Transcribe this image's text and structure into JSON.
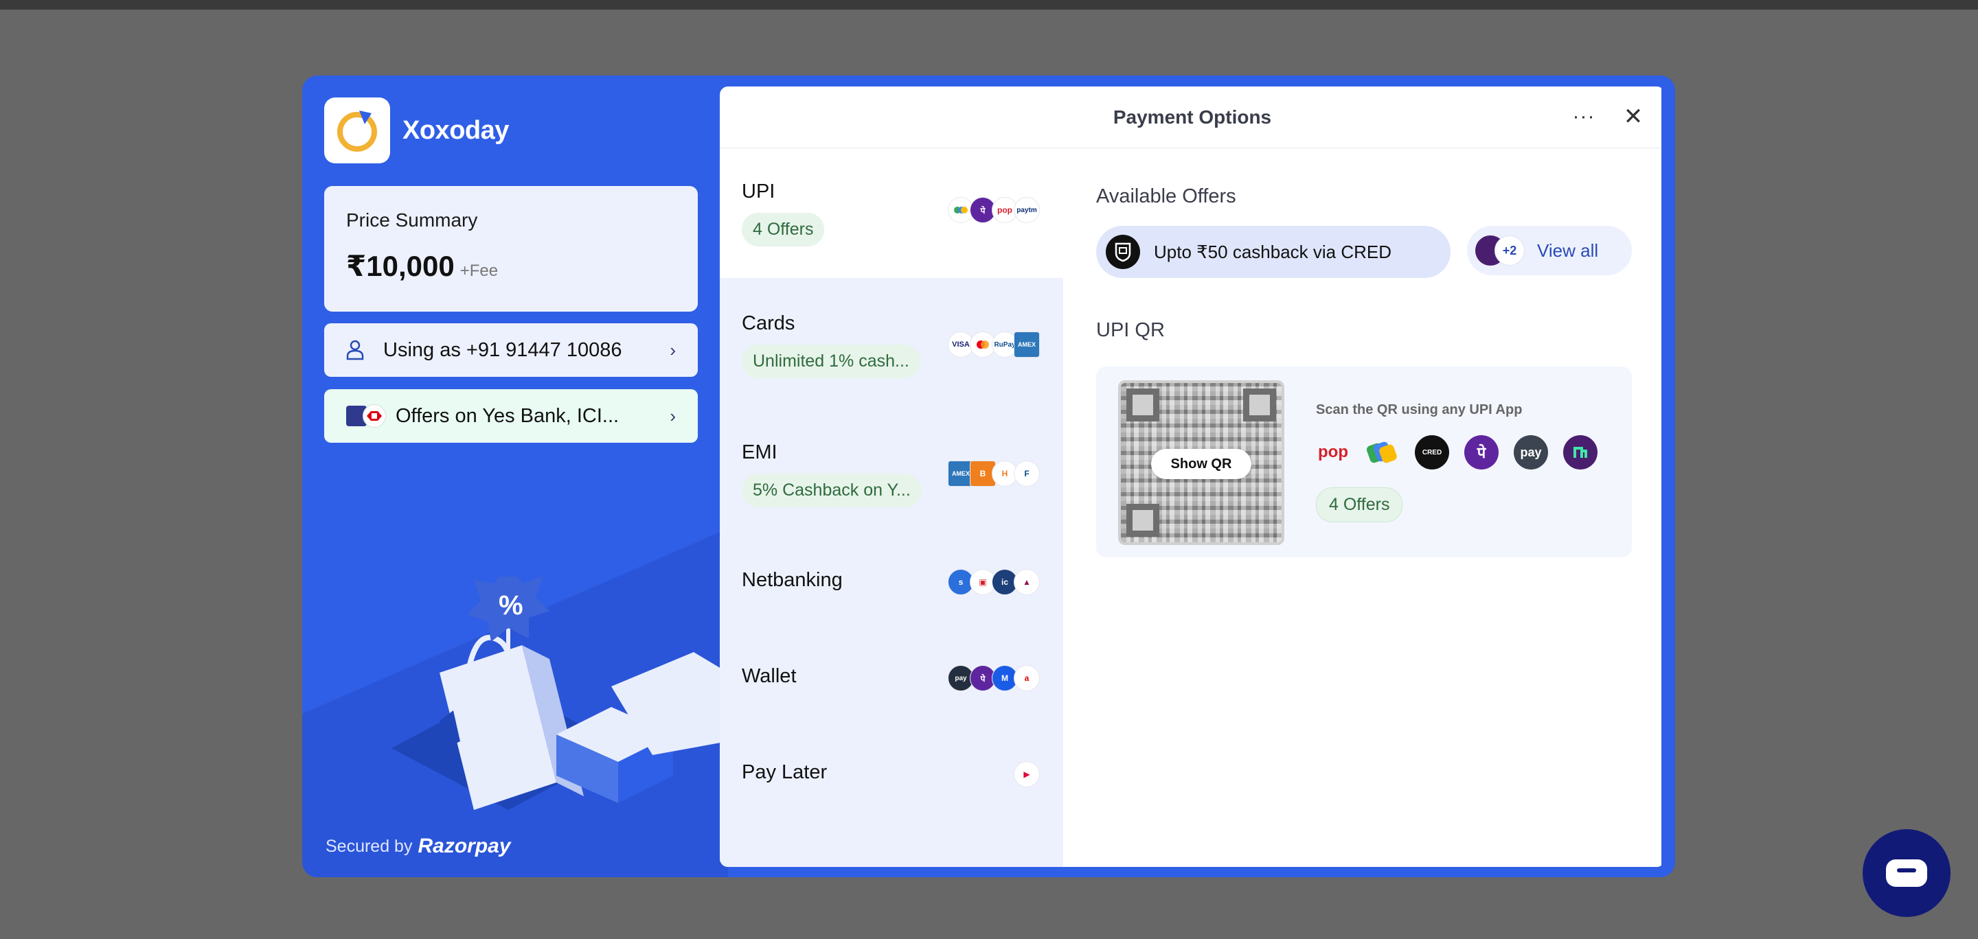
{
  "merchant": {
    "name": "Xoxoday"
  },
  "price_summary": {
    "title": "Price Summary",
    "amount": "₹10,000",
    "fee": "+Fee"
  },
  "user_pill": {
    "label": "Using as +91 91447 10086"
  },
  "offers_pill": {
    "label": "Offers on Yes Bank, ICI..."
  },
  "secured": {
    "prefix": "Secured by",
    "brand": "Razorpay"
  },
  "panel": {
    "title": "Payment Options",
    "more_label": "···",
    "close_label": "✕"
  },
  "methods": [
    {
      "name": "UPI",
      "badge": "4 Offers",
      "icons": [
        "gpay",
        "phonepe",
        "popup",
        "paytm"
      ]
    },
    {
      "name": "Cards",
      "badge": "Unlimited 1% cash...",
      "icons": [
        "visa",
        "mastercard",
        "rupay",
        "amex"
      ]
    },
    {
      "name": "EMI",
      "badge": "5% Cashback on Y...",
      "icons": [
        "amex",
        "bajaj",
        "hdfc",
        "flexmoney"
      ]
    },
    {
      "name": "Netbanking",
      "badge": "",
      "icons": [
        "sbi",
        "hdfc",
        "icici",
        "axis"
      ]
    },
    {
      "name": "Wallet",
      "badge": "",
      "icons": [
        "amazonpay",
        "phonepe",
        "mobikwik",
        "airtel"
      ]
    },
    {
      "name": "Pay Later",
      "badge": "",
      "icons": [
        "lazypay"
      ]
    }
  ],
  "offers": {
    "title": "Available Offers",
    "primary": "Upto ₹50 cashback via CRED",
    "more_count": "+2",
    "view_all": "View all"
  },
  "upi_qr": {
    "title": "UPI QR",
    "show_qr": "Show QR",
    "scan_text": "Scan the QR using any UPI App",
    "apps": [
      "pop",
      "gpay",
      "cred",
      "phonepe",
      "amazonpay",
      "navi"
    ],
    "badge": "4 Offers"
  },
  "colors": {
    "brand_blue": "#2f5fe6",
    "offer_green_bg": "#e7f4ea",
    "offer_green_text": "#2f6b3e",
    "list_bg": "#edf1fd"
  }
}
